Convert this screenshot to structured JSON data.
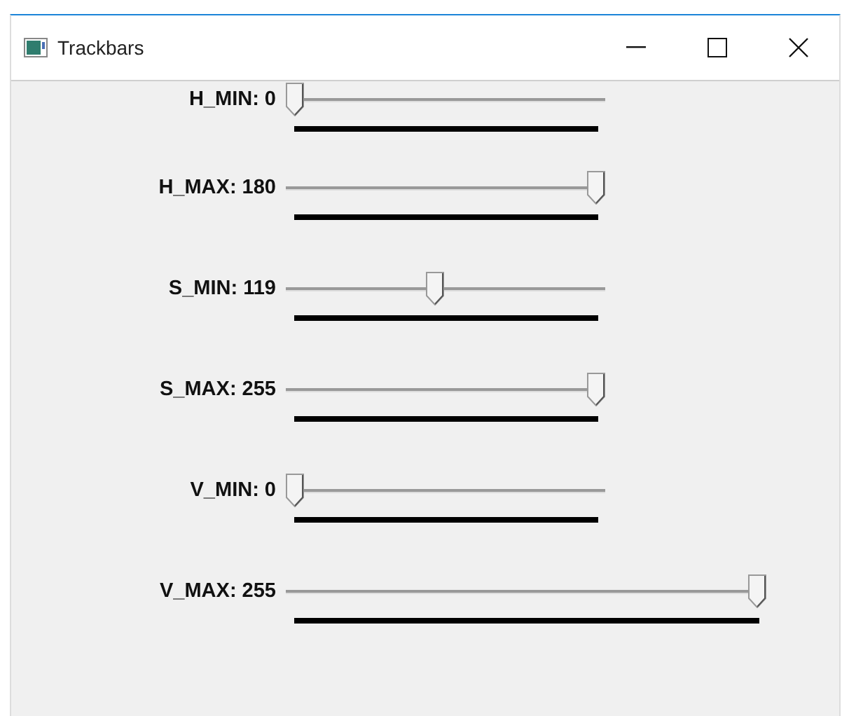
{
  "window": {
    "title": "Trackbars"
  },
  "trackbars": [
    {
      "label": "H_MIN: 0",
      "level": 0,
      "kind": "short"
    },
    {
      "label": "H_MAX: 180",
      "level": 1,
      "kind": "short"
    },
    {
      "label": "S_MIN: 119",
      "level": 0.467,
      "kind": "short"
    },
    {
      "label": "S_MAX: 255",
      "level": 1,
      "kind": "short"
    },
    {
      "label": "V_MIN: 0",
      "level": 0,
      "kind": "short"
    },
    {
      "label": "V_MAX: 255",
      "level": 1,
      "kind": "long"
    }
  ]
}
